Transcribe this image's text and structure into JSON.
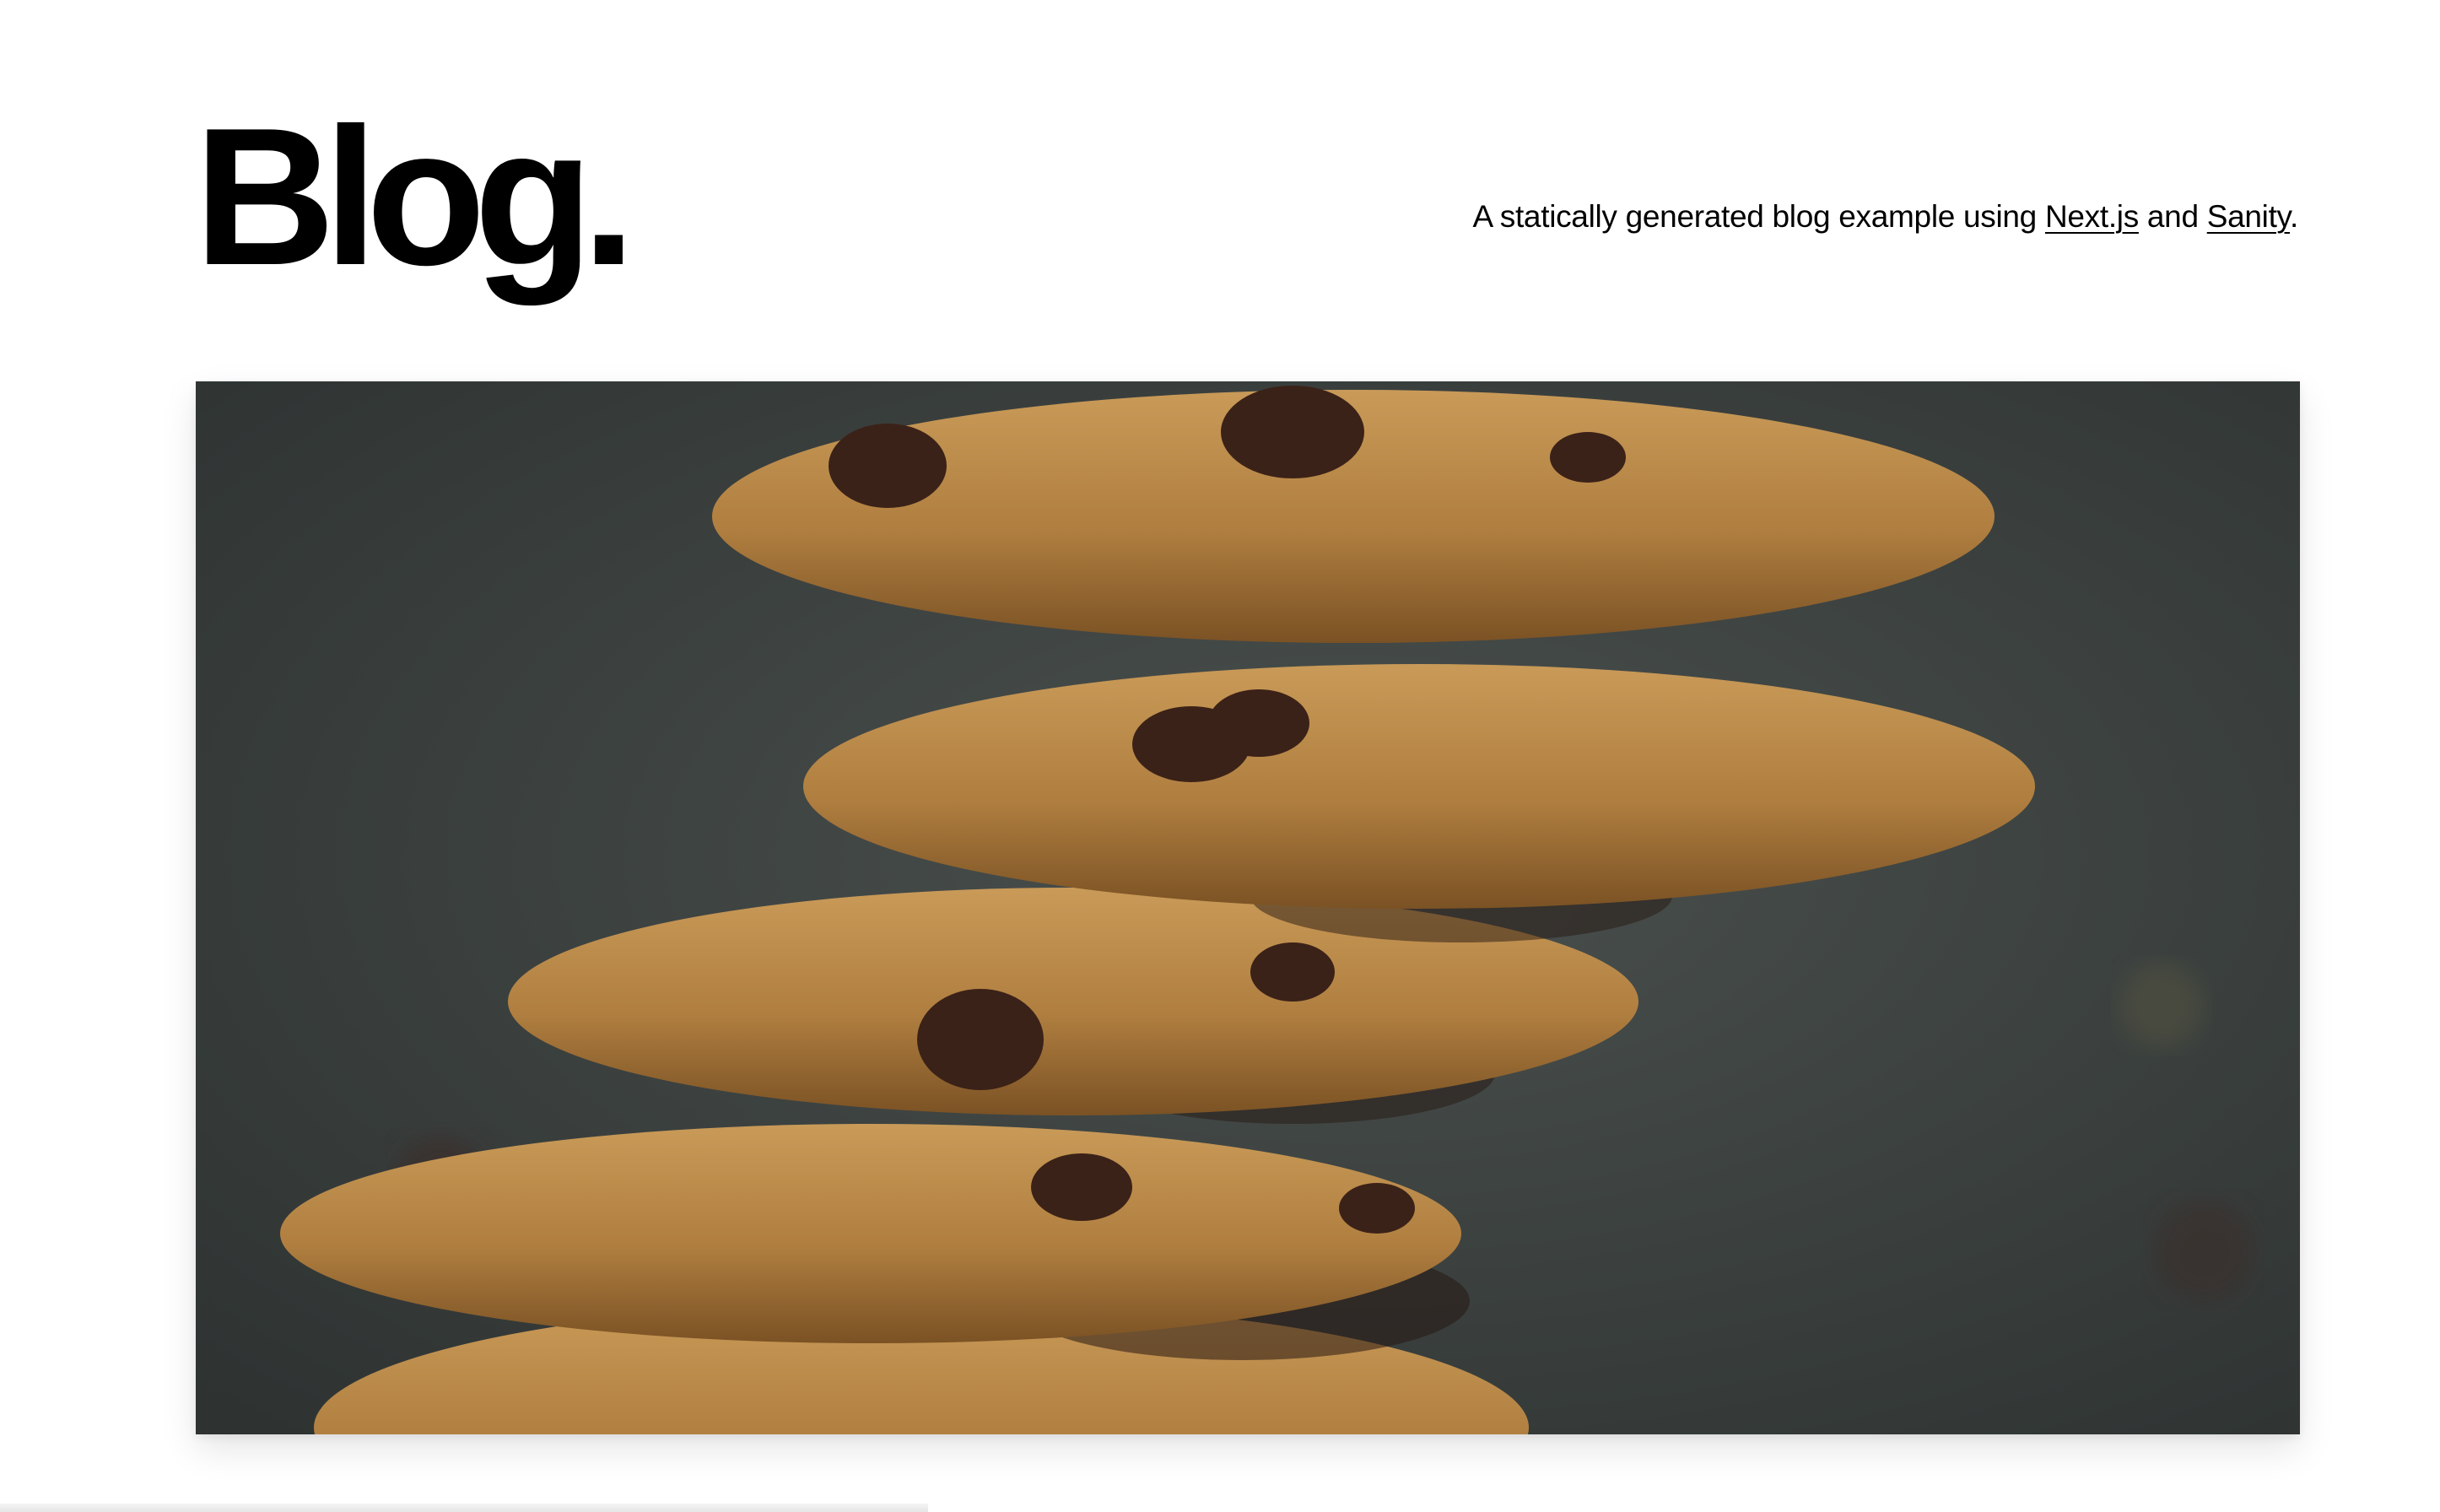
{
  "header": {
    "title": "Blog."
  },
  "intro": {
    "prefix": "A statically generated blog example using ",
    "link_nextjs": "Next.js",
    "middle": " and ",
    "link_sanity": "Sanity",
    "suffix": "."
  },
  "hero": {
    "image_subject": "stack-of-oatmeal-chocolate-chip-cookies",
    "colors": {
      "background": "#3a3f3e",
      "cookie": "#b68a4c",
      "cookie_shadow": "#7a5428",
      "chocolate": "#3b2218"
    }
  }
}
